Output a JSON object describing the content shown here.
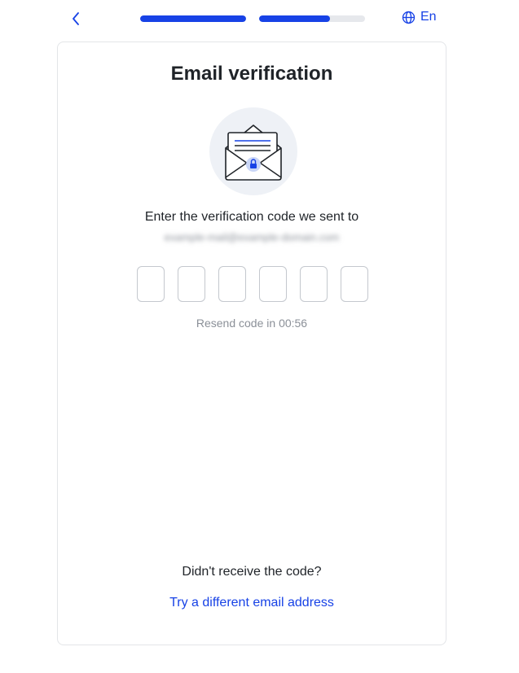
{
  "header": {
    "back_icon": "chevron-left-icon",
    "progress": [
      {
        "value": 1.0
      },
      {
        "value": 0.67
      }
    ],
    "language": {
      "icon": "globe-icon",
      "label": "En"
    }
  },
  "card": {
    "title": "Email verification",
    "illustration_icon": "envelope-lock-icon",
    "instruction": "Enter the verification code we sent to",
    "email_masked": "example-mail@example-domain.com",
    "code_inputs": [
      "",
      "",
      "",
      "",
      "",
      ""
    ],
    "resend_prefix": "Resend code in",
    "resend_timer": "00:56",
    "didnt_receive": "Didn't receive the code?",
    "try_different": "Try a different email address"
  },
  "colors": {
    "accent": "#1742e6",
    "muted_text": "#8b9098",
    "border": "#e3e5e8"
  }
}
